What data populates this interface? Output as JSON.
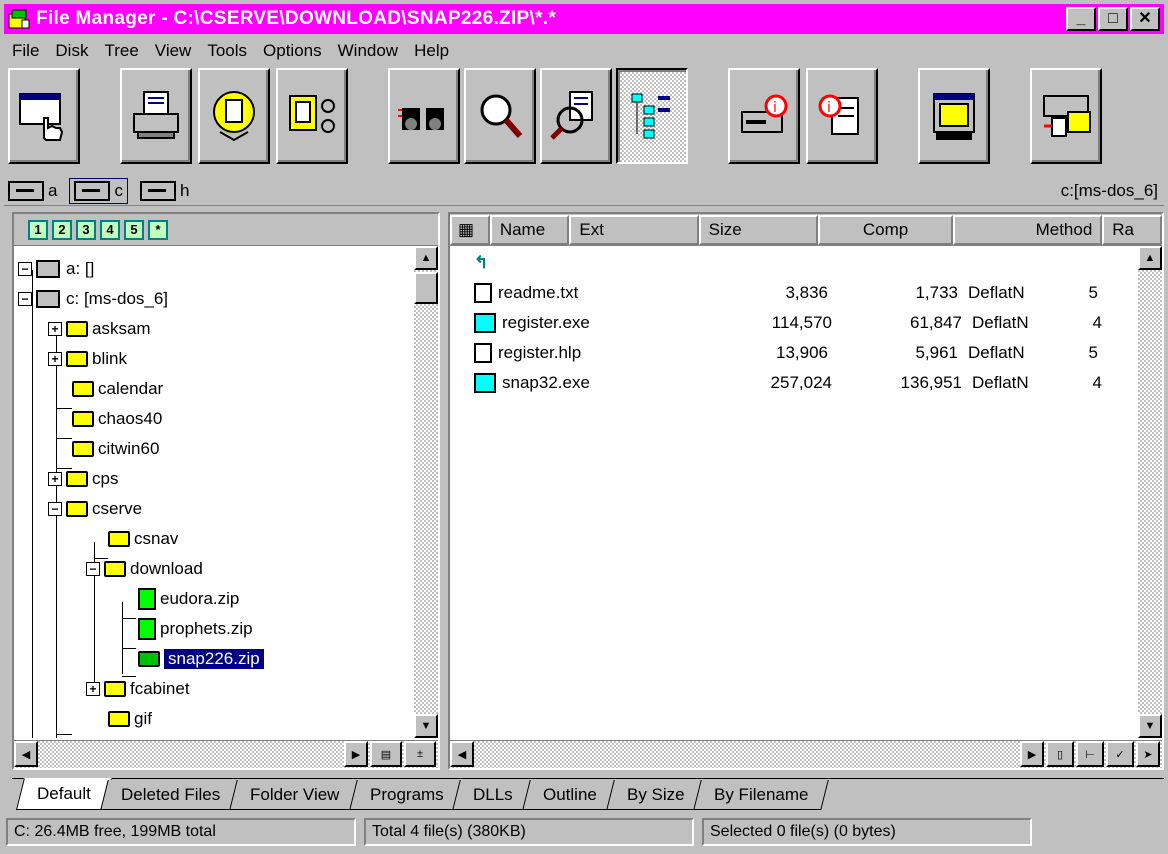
{
  "window": {
    "title": "File Manager - C:\\CSERVE\\DOWNLOAD\\SNAP226.ZIP\\*.*",
    "minimize": "_",
    "maximize": "□",
    "close": "✕"
  },
  "menu": [
    "File",
    "Disk",
    "Tree",
    "View",
    "Tools",
    "Options",
    "Window",
    "Help"
  ],
  "toolbar": {
    "buttons": [
      "hand-icon",
      "printer-icon",
      "find-icon",
      "zip-tools-icon",
      "binoculars-icon",
      "magnifier-icon",
      "search-doc-icon",
      "tree-view-icon",
      "disk-info-icon",
      "file-info-icon",
      "window-icon",
      "drive-transfer-icon"
    ]
  },
  "drives": [
    {
      "letter": "a",
      "active": false
    },
    {
      "letter": "c",
      "active": true
    },
    {
      "letter": "h",
      "active": false
    }
  ],
  "current_drive_label": "c:[ms-dos_6]",
  "tree": {
    "level_buttons": [
      "1",
      "2",
      "3",
      "4",
      "5",
      "*"
    ],
    "items": [
      {
        "label": "a: []",
        "level": 0,
        "expander": "−"
      },
      {
        "label": "c: [ms-dos_6]",
        "level": 0,
        "expander": "−"
      },
      {
        "label": "asksam",
        "level": 1,
        "expander": "+"
      },
      {
        "label": "blink",
        "level": 1,
        "expander": "+"
      },
      {
        "label": "calendar",
        "level": 1,
        "expander": ""
      },
      {
        "label": "chaos40",
        "level": 1,
        "expander": ""
      },
      {
        "label": "citwin60",
        "level": 1,
        "expander": ""
      },
      {
        "label": "cps",
        "level": 1,
        "expander": "+"
      },
      {
        "label": "cserve",
        "level": 1,
        "expander": "−"
      },
      {
        "label": "csnav",
        "level": 2,
        "expander": ""
      },
      {
        "label": "download",
        "level": 2,
        "expander": "−"
      },
      {
        "label": "eudora.zip",
        "level": 3,
        "expander": ""
      },
      {
        "label": "prophets.zip",
        "level": 3,
        "expander": ""
      },
      {
        "label": "snap226.zip",
        "level": 3,
        "expander": "",
        "selected": true
      },
      {
        "label": "fcabinet",
        "level": 1,
        "expander": "+"
      },
      {
        "label": "gif",
        "level": 1,
        "expander": ""
      }
    ]
  },
  "file_list": {
    "columns": [
      "Name",
      "Ext",
      "Size",
      "Comp",
      "Method",
      "Ra"
    ],
    "parent_arrow": "↰",
    "files": [
      {
        "name": "readme.txt",
        "size": "3,836",
        "comp": "1,733",
        "method": "DeflatN",
        "ra": "5",
        "type": "doc"
      },
      {
        "name": "register.exe",
        "size": "114,570",
        "comp": "61,847",
        "method": "DeflatN",
        "ra": "4",
        "type": "exe"
      },
      {
        "name": "register.hlp",
        "size": "13,906",
        "comp": "5,961",
        "method": "DeflatN",
        "ra": "5",
        "type": "doc"
      },
      {
        "name": "snap32.exe",
        "size": "257,024",
        "comp": "136,951",
        "method": "DeflatN",
        "ra": "4",
        "type": "exe"
      }
    ]
  },
  "tabs": [
    "Default",
    "Deleted Files",
    "Folder View",
    "Programs",
    "DLLs",
    "Outline",
    "By Size",
    "By Filename"
  ],
  "active_tab": "Default",
  "status": {
    "disk": "C: 26.4MB free, 199MB total",
    "total": "Total 4 file(s) (380KB)",
    "selected": "Selected 0 file(s) (0 bytes)"
  }
}
